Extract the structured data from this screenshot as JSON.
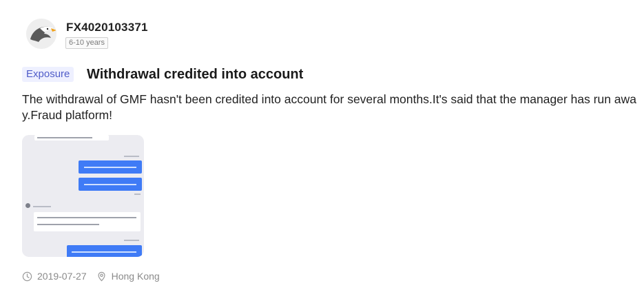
{
  "user": {
    "name": "FX4020103371",
    "experience": "6-10 years"
  },
  "post": {
    "tag": "Exposure",
    "title": "Withdrawal credited into account",
    "content": "The withdrawal of GMF hasn't been credited into account for several months.It's said that the manager has run away.Fraud platform!"
  },
  "meta": {
    "date": "2019-07-27",
    "location": "Hong Kong",
    "date_icon": "clock-icon",
    "location_icon": "location-pin-icon"
  },
  "colors": {
    "tag_bg": "#eef0ff",
    "tag_text": "#4f5cc8",
    "chat_bubble": "#3f7bf6"
  }
}
